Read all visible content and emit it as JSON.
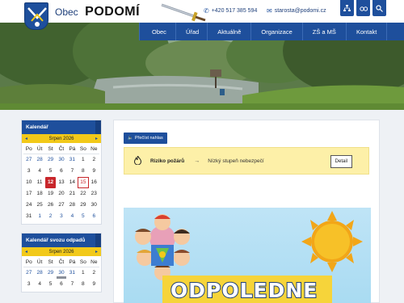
{
  "header": {
    "brand_small": "Obec",
    "brand_big": "PODOMÍ",
    "phone": "+420 517 385 594",
    "email": "starosta@podomi.cz",
    "tools": [
      {
        "icon": "sitemap-icon",
        "glyph": "⌘"
      },
      {
        "icon": "font-size-icon",
        "glyph": "ձ"
      },
      {
        "icon": "search-icon",
        "glyph": "⚲"
      }
    ]
  },
  "nav": {
    "items": [
      "Obec",
      "Úřad",
      "Aktuálně",
      "Organizace",
      "ZŠ a MŠ",
      "Kontakt"
    ]
  },
  "calendar": {
    "title": "Kalendář",
    "month": "Srpen 2026",
    "prev": "◂",
    "next": "▸",
    "weekdays": [
      "Po",
      "Út",
      "St",
      "Čt",
      "Pá",
      "So",
      "Ne"
    ],
    "weeks": [
      [
        "27",
        "28",
        "29",
        "30",
        "31",
        "1",
        "2"
      ],
      [
        "3",
        "4",
        "5",
        "6",
        "7",
        "8",
        "9"
      ],
      [
        "10",
        "11",
        "12",
        "13",
        "14",
        "15",
        "16"
      ],
      [
        "17",
        "18",
        "19",
        "20",
        "21",
        "22",
        "23"
      ],
      [
        "24",
        "25",
        "26",
        "27",
        "28",
        "29",
        "30"
      ],
      [
        "31",
        "1",
        "2",
        "3",
        "4",
        "5",
        "6"
      ]
    ]
  },
  "waste_calendar": {
    "title": "Kalendář svozu odpadů",
    "month": "Srpen 2026",
    "prev": "◂",
    "next": "▸",
    "weekdays": [
      "Po",
      "Út",
      "St",
      "Čt",
      "Pá",
      "So",
      "Ne"
    ],
    "weeks": [
      [
        "27",
        "28",
        "29",
        "30",
        "31",
        "1",
        "2"
      ],
      [
        "3",
        "4",
        "5",
        "6",
        "7",
        "8",
        "9"
      ]
    ]
  },
  "main": {
    "read_aloud": "Přečíst nahlas",
    "alert": {
      "title": "Riziko požárů",
      "arrow": "→",
      "level": "Nízký stupeň nebezpečí",
      "detail": "Detail"
    },
    "poster_word": "ODPOLEDNE"
  },
  "colors": {
    "brand_blue": "#1e4f9c",
    "accent_yellow": "#f2c919",
    "today_red": "#c8262b"
  }
}
